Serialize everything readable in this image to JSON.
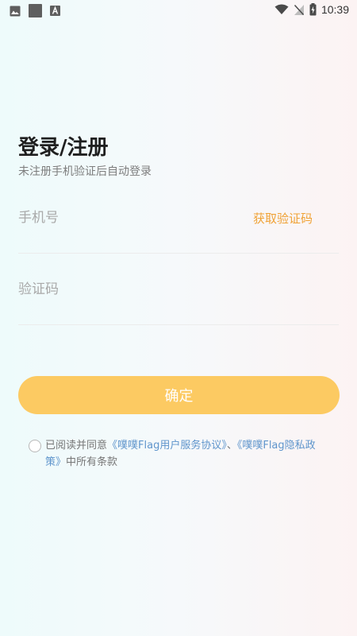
{
  "status_bar": {
    "time": "10:39",
    "left_icons": [
      "image-icon",
      "app-square-icon",
      "font-icon"
    ],
    "right_icons": [
      "wifi-icon",
      "no-signal-icon",
      "battery-charging-icon"
    ]
  },
  "login": {
    "title": "登录/注册",
    "subtitle": "未注册手机验证后自动登录",
    "phone_placeholder": "手机号",
    "get_code_label": "获取验证码",
    "code_placeholder": "验证码",
    "confirm_label": "确定"
  },
  "agreement": {
    "prefix": "已阅读并同意",
    "service_link": "《噗噗Flag用户服务协议》",
    "separator": "、",
    "privacy_link": "《噗噗Flag隐私政策》",
    "suffix": "中所有条款",
    "checked": false
  },
  "colors": {
    "accent": "#f0a236",
    "button": "#fcca62",
    "link": "#5f95cc"
  }
}
